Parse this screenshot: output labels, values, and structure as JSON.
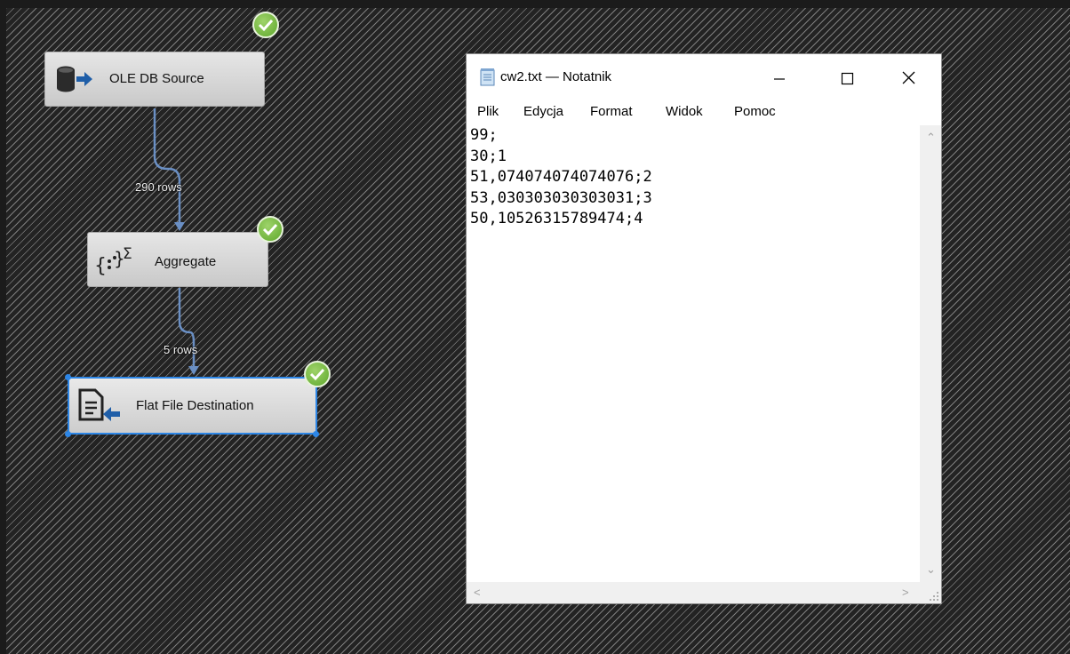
{
  "dataflow": {
    "source": {
      "label": "OLE DB Source"
    },
    "aggregate": {
      "label": "Aggregate"
    },
    "destination": {
      "label": "Flat File Destination"
    },
    "path1_label": "290 rows",
    "path2_label": "5 rows"
  },
  "notepad": {
    "title": "cw2.txt — Notatnik",
    "menu": [
      "Plik",
      "Edycja",
      "Format",
      "Widok",
      "Pomoc"
    ],
    "lines": [
      "99;",
      "30;1",
      "51,074074074074076;2",
      "53,030303030303031;3",
      "50,10526315789474;4"
    ]
  },
  "colors": {
    "selection_blue": "#2d86e6",
    "success_green": "#6db33f",
    "connector": "#6a8fc4"
  }
}
